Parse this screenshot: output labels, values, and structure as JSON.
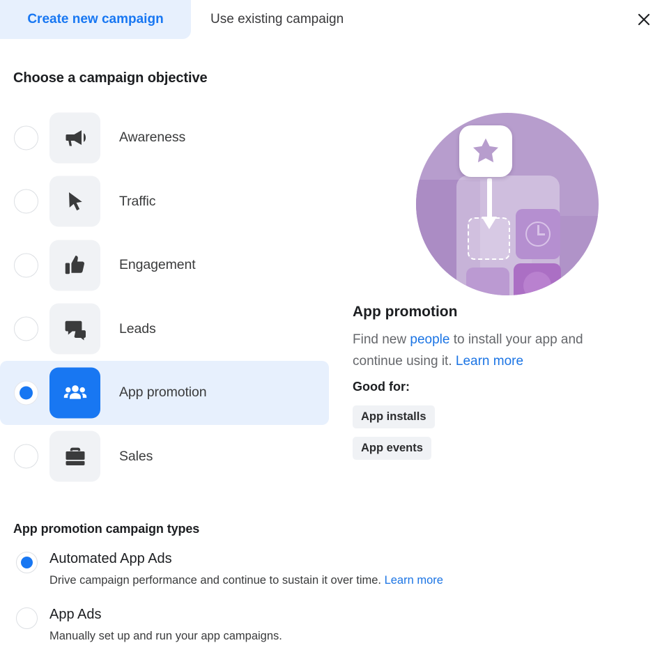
{
  "header": {
    "tabs": [
      {
        "label": "Create new campaign",
        "active": true
      },
      {
        "label": "Use existing campaign",
        "active": false
      }
    ],
    "close_icon": "close-icon",
    "accent_color": "#1877f2",
    "active_tab_bg": "#e7f0fd"
  },
  "objective_section": {
    "heading": "Choose a campaign objective",
    "options": [
      {
        "label": "Awareness",
        "icon": "megaphone-icon",
        "selected": false
      },
      {
        "label": "Traffic",
        "icon": "cursor-icon",
        "selected": false
      },
      {
        "label": "Engagement",
        "icon": "thumbs-up-icon",
        "selected": false
      },
      {
        "label": "Leads",
        "icon": "speech-bubbles-icon",
        "selected": false
      },
      {
        "label": "App promotion",
        "icon": "people-group-icon",
        "selected": true
      },
      {
        "label": "Sales",
        "icon": "briefcase-icon",
        "selected": false
      }
    ]
  },
  "detail_panel": {
    "illustration": "app-install-illustration",
    "illustration_color": "#b79dcd",
    "title": "App promotion",
    "description_part1": "Find new ",
    "description_link1": "people",
    "description_part2": " to install your app and continue using it. ",
    "description_link2": "Learn more",
    "good_for_label": "Good for:",
    "badges": [
      "App installs",
      "App events"
    ]
  },
  "campaign_types": {
    "heading": "App promotion campaign types",
    "options": [
      {
        "title": "Automated App Ads",
        "description": "Drive campaign performance and continue to sustain it over time. ",
        "link": "Learn more",
        "selected": true
      },
      {
        "title": "App Ads",
        "description": "Manually set up and run your app campaigns.",
        "link": "",
        "selected": false
      }
    ]
  }
}
